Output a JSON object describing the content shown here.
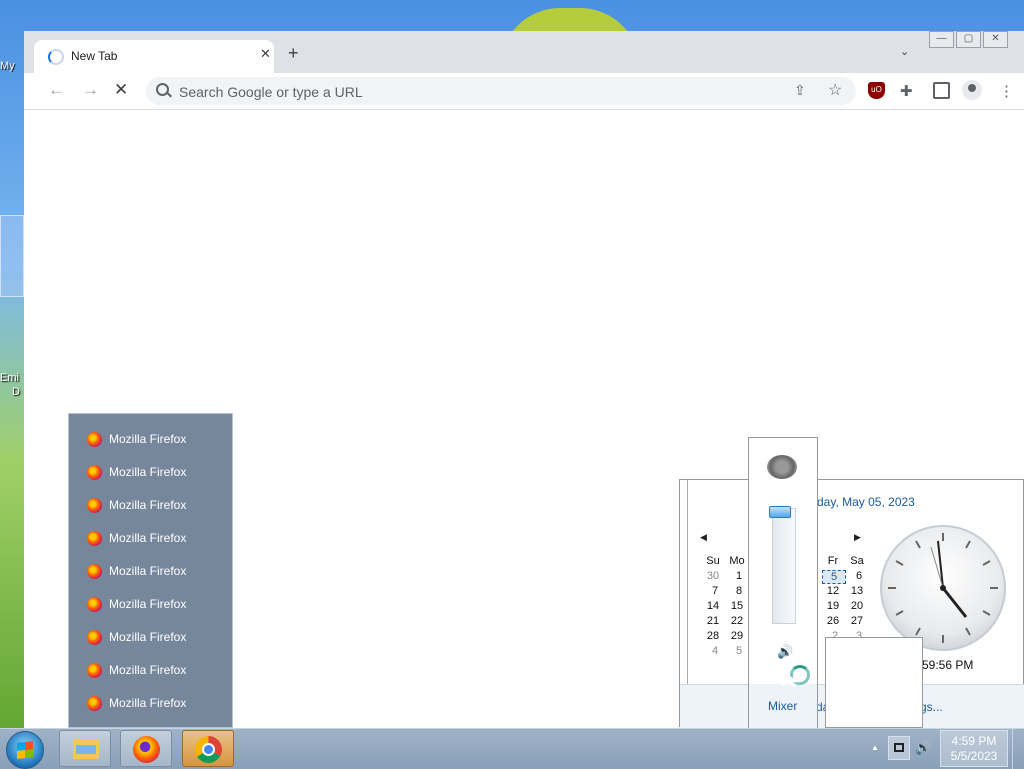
{
  "desktop": {
    "icon_labels": [
      "My",
      "",
      "",
      "Emi",
      "D"
    ]
  },
  "browser": {
    "tab": {
      "title": "New Tab",
      "close": "✕"
    },
    "new_tab": "+",
    "tab_search": "⌄",
    "window_buttons": [
      "—",
      "▢",
      "✕"
    ],
    "nav": {
      "back": "←",
      "forward": "→",
      "stop": "✕"
    },
    "omnibox": {
      "placeholder": "Search Google or type a URL"
    },
    "icons": {
      "share": "⇪",
      "bookmark": "☆",
      "ublock": "uO",
      "extensions": "✚",
      "menu": "⋮"
    }
  },
  "jump_list": {
    "items": [
      "Mozilla Firefox",
      "Mozilla Firefox",
      "Mozilla Firefox",
      "Mozilla Firefox",
      "Mozilla Firefox",
      "Mozilla Firefox",
      "Mozilla Firefox",
      "Mozilla Firefox",
      "Mozilla Firefox"
    ]
  },
  "calendar": {
    "date_text": "day, May 05, 2023",
    "headers": [
      "Su",
      "Mo",
      "Fr",
      "Sa"
    ],
    "rows": [
      [
        "30",
        "1",
        "5",
        "6"
      ],
      [
        "7",
        "8",
        "12",
        "13"
      ],
      [
        "14",
        "15",
        "19",
        "20"
      ],
      [
        "21",
        "22",
        "26",
        "27"
      ],
      [
        "28",
        "29",
        "2",
        "3"
      ],
      [
        "4",
        "5",
        "",
        ""
      ]
    ],
    "time_text": "59:56 PM",
    "link1": "da",
    "link2": "gs..."
  },
  "volume": {
    "level": 0.97,
    "mixer_label": "Mixer",
    "speaker_icon": "🔊"
  },
  "taskbar": {
    "time": "4:59 PM",
    "date": "5/5/2023",
    "tray_arrow": "▲",
    "speaker": "🔊"
  },
  "colors": {
    "link": "#1e5aa0",
    "jumplist_bg": "#76879c"
  }
}
